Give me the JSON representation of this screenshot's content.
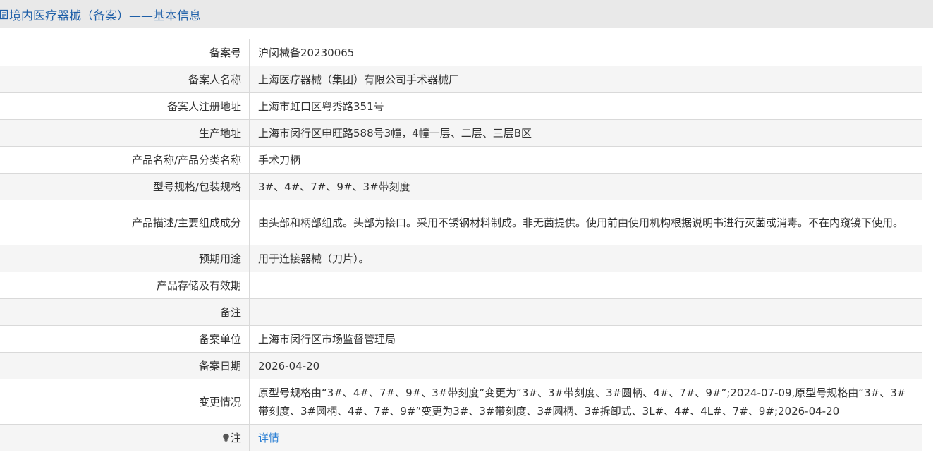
{
  "header": {
    "title": "境内医疗器械（备案）——基本信息"
  },
  "rows": [
    {
      "label": "备案号",
      "value": "沪闵械备20230065"
    },
    {
      "label": "备案人名称",
      "value": "上海医疗器械（集团）有限公司手术器械厂"
    },
    {
      "label": "备案人注册地址",
      "value": "上海市虹口区粤秀路351号"
    },
    {
      "label": "生产地址",
      "value": "上海市闵行区申旺路588号3幢，4幢一层、二层、三层B区"
    },
    {
      "label": "产品名称/产品分类名称",
      "value": "手术刀柄"
    },
    {
      "label": "型号规格/包装规格",
      "value": "3#、4#、7#、9#、3#带刻度"
    },
    {
      "label": "产品描述/主要组成成分",
      "value": "由头部和柄部组成。头部为接口。采用不锈钢材料制成。非无菌提供。使用前由使用机构根据说明书进行灭菌或消毒。不在内窥镜下使用。"
    },
    {
      "label": "预期用途",
      "value": "用于连接器械（刀片）。"
    },
    {
      "label": "产品存储及有效期",
      "value": ""
    },
    {
      "label": "备注",
      "value": ""
    },
    {
      "label": "备案单位",
      "value": "上海市闵行区市场监督管理局"
    },
    {
      "label": "备案日期",
      "value": "2026-04-20"
    },
    {
      "label": "变更情况",
      "value": "原型号规格由“3#、4#、7#、9#、3#带刻度”变更为“3#、3#带刻度、3#圆柄、4#、7#、9#”;2024-07-09,原型号规格由“3#、3#带刻度、3#圆柄、4#、7#、9#”变更为3#、3#带刻度、3#圆柄、3#拆卸式、3L#、4#、4L#、7#、9#;2026-04-20"
    }
  ],
  "note": {
    "label": "注",
    "link_text": "详情",
    "icon": "lightbulb-icon"
  },
  "colors": {
    "header_bg": "#e9e9e9",
    "title": "#1e5fa8",
    "link": "#2a7fd4",
    "row_alt": "#f5f5f5",
    "border": "#d9d9d9"
  }
}
